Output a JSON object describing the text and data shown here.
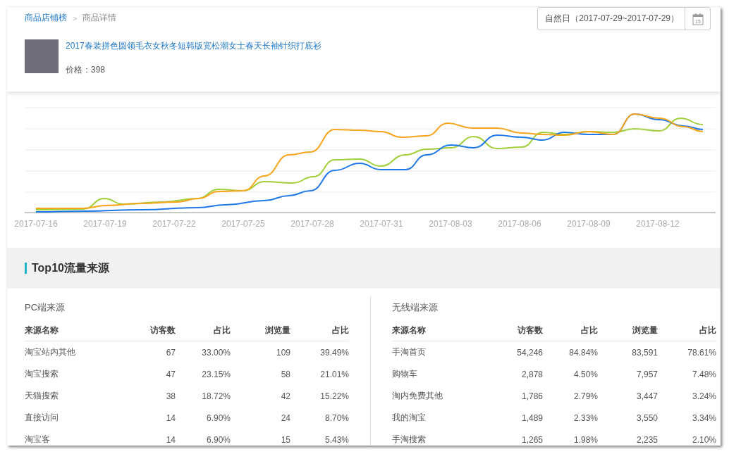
{
  "breadcrumb": {
    "separator": ">",
    "items": [
      {
        "label": "商品店铺榜",
        "kind": "link"
      },
      {
        "label": "商品详情",
        "kind": "current"
      }
    ]
  },
  "product": {
    "title": "2017春装拼色圆领毛衣女秋冬短韩版宽松潮女士春天长袖针织打底衫",
    "price": "价格：398"
  },
  "date_range": {
    "label": "自然日（2017-07-29~2017-07-29）",
    "calendar_day": "15"
  },
  "trend_chart": {
    "x_labels": [
      "2017-07-16",
      "2017-07-19",
      "2017-07-22",
      "2017-07-25",
      "2017-07-28",
      "2017-07-31",
      "2017-08-03",
      "2017-08-06",
      "2017-08-09",
      "2017-08-12"
    ]
  },
  "section": {
    "title": "Top10流量来源"
  },
  "tables": [
    {
      "title": "PC端来源",
      "columns": [
        "来源名称",
        "访客数",
        "占比",
        "浏览量",
        "占比"
      ],
      "rows": [
        [
          "淘宝站内其他",
          "67",
          "33.00%",
          "109",
          "39.49%"
        ],
        [
          "淘宝搜索",
          "47",
          "23.15%",
          "58",
          "21.01%"
        ],
        [
          "天猫搜索",
          "38",
          "18.72%",
          "42",
          "15.22%"
        ],
        [
          "直接访问",
          "14",
          "6.90%",
          "24",
          "8.70%"
        ],
        [
          "淘宝客",
          "14",
          "6.90%",
          "15",
          "5.43%"
        ]
      ]
    },
    {
      "title": "无线端来源",
      "columns": [
        "来源名称",
        "访客数",
        "占比",
        "浏览量",
        "占比"
      ],
      "rows": [
        [
          "手淘首页",
          "54,246",
          "84.84%",
          "83,591",
          "78.61%"
        ],
        [
          "购物车",
          "2,878",
          "4.50%",
          "7,957",
          "7.48%"
        ],
        [
          "淘内免费其他",
          "1,786",
          "2.79%",
          "3,447",
          "3.24%"
        ],
        [
          "我的淘宝",
          "1,489",
          "2.33%",
          "3,550",
          "3.34%"
        ],
        [
          "手淘搜索",
          "1,265",
          "1.98%",
          "2,235",
          "2.10%"
        ]
      ]
    }
  ]
}
